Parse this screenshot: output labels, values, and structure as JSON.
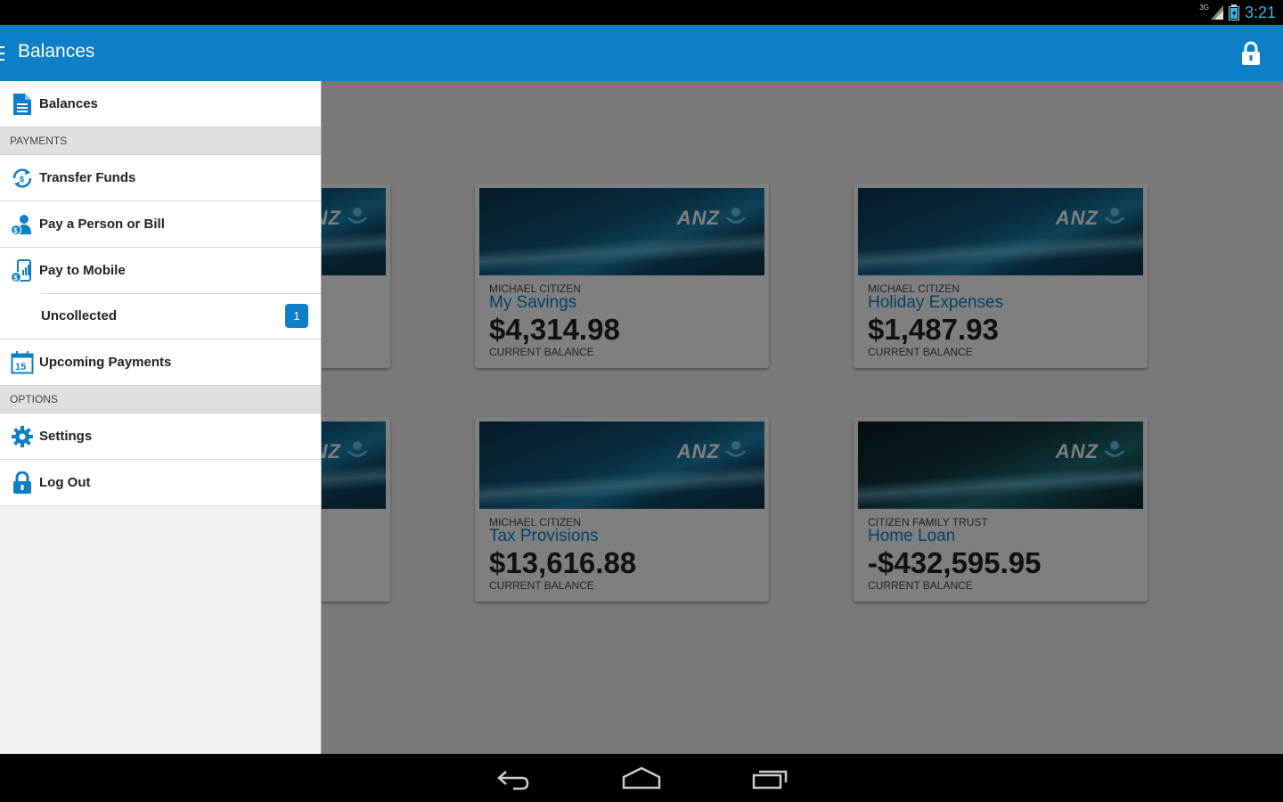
{
  "status_bar": {
    "network": "3G",
    "time": "3:21"
  },
  "app_bar": {
    "title": "Balances"
  },
  "drawer": {
    "top_item": {
      "label": "Balances",
      "icon": "document-icon"
    },
    "sections": [
      {
        "header": "PAYMENTS",
        "items": [
          {
            "label": "Transfer Funds",
            "icon": "transfer-icon"
          },
          {
            "label": "Pay a Person or Bill",
            "icon": "pay-person-icon"
          },
          {
            "label": "Pay to Mobile",
            "icon": "mobile-pay-icon"
          }
        ],
        "sub_item": {
          "label": "Uncollected",
          "badge": "1"
        },
        "extra_item": {
          "label": "Upcoming Payments",
          "icon": "calendar-icon",
          "icon_text": "15"
        }
      },
      {
        "header": "OPTIONS",
        "items": [
          {
            "label": "Settings",
            "icon": "gear-icon"
          },
          {
            "label": "Log Out",
            "icon": "lock-icon"
          }
        ]
      }
    ]
  },
  "accounts": [
    {
      "owner": "MICHAEL CITIZEN",
      "name": "My Savings",
      "balance": "$4,314.98",
      "balance_label": "CURRENT BALANCE"
    },
    {
      "owner": "MICHAEL CITIZEN",
      "name": "Holiday Expenses",
      "balance": "$1,487.93",
      "balance_label": "CURRENT BALANCE"
    },
    {
      "owner": "MICHAEL CITIZEN",
      "name": "Tax Provisions",
      "balance": "$13,616.88",
      "balance_label": "CURRENT BALANCE"
    },
    {
      "owner": "CITIZEN FAMILY TRUST",
      "name": "Home Loan",
      "balance": "-$432,595.95",
      "balance_label": "CURRENT BALANCE"
    }
  ],
  "brand": {
    "logo_text": "ANZ",
    "primary_color": "#0c7fc7"
  },
  "nav_bar": {
    "icons": [
      "back-icon",
      "home-icon",
      "recent-apps-icon"
    ]
  }
}
